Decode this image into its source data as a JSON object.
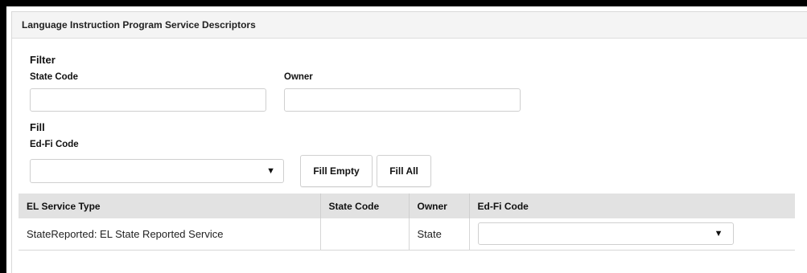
{
  "panel": {
    "title": "Language Instruction Program Service Descriptors"
  },
  "filter": {
    "heading": "Filter",
    "state_code_label": "State Code",
    "state_code_value": "",
    "owner_label": "Owner",
    "owner_value": ""
  },
  "fill": {
    "heading": "Fill",
    "edfi_code_label": "Ed-Fi Code",
    "edfi_code_selected": "",
    "fill_empty_label": "Fill Empty",
    "fill_all_label": "Fill All"
  },
  "table": {
    "columns": [
      "EL Service Type",
      "State Code",
      "Owner",
      "Ed-Fi Code"
    ],
    "rows": [
      {
        "service_type": "StateReported: EL State Reported Service",
        "state_code": "",
        "owner": "State",
        "edfi_code": ""
      }
    ]
  },
  "icons": {
    "dropdown_caret": "▼"
  },
  "colors": {
    "header_bg": "#f4f4f4",
    "table_header_bg": "#e2e2e2",
    "border": "#cfcfcf"
  }
}
